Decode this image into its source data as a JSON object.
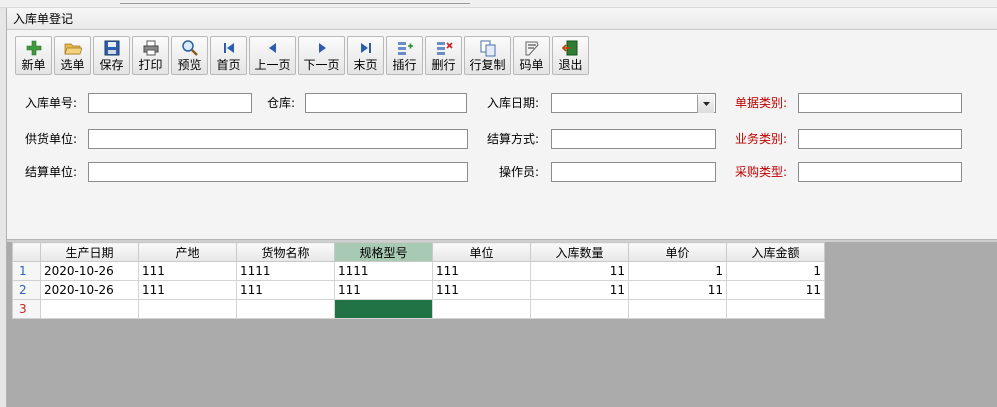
{
  "window": {
    "title": "入库单登记"
  },
  "toolbar": {
    "new": "新单",
    "select": "选单",
    "save": "保存",
    "print": "打印",
    "preview": "预览",
    "first": "首页",
    "prev": "上一页",
    "next": "下一页",
    "last": "末页",
    "insert_row": "插行",
    "delete_row": "删行",
    "copy_row": "行复制",
    "barcode": "码单",
    "exit": "退出"
  },
  "form": {
    "order_no_label": "入库单号:",
    "order_no_value": "",
    "warehouse_label": "仓库:",
    "warehouse_value": "",
    "date_label": "入库日期:",
    "date_value": "",
    "doc_type_label": "单据类别:",
    "doc_type_value": "",
    "supplier_label": "供货单位:",
    "supplier_value": "",
    "settle_method_label": "结算方式:",
    "settle_method_value": "",
    "biz_type_label": "业务类别:",
    "biz_type_value": "",
    "settle_unit_label": "结算单位:",
    "settle_unit_value": "",
    "operator_label": "操作员:",
    "operator_value": "",
    "purchase_type_label": "采购类型:",
    "purchase_type_value": ""
  },
  "grid": {
    "columns": [
      "生产日期",
      "产地",
      "货物名称",
      "规格型号",
      "单位",
      "入库数量",
      "单价",
      "入库金额"
    ],
    "rows": [
      {
        "no": "1",
        "cells": [
          "2020-10-26",
          "111",
          "1111",
          "1111",
          "111",
          "11",
          "1",
          "1"
        ]
      },
      {
        "no": "2",
        "cells": [
          "2020-10-26",
          "111",
          "111",
          "111",
          "111",
          "11",
          "11",
          "11"
        ]
      },
      {
        "no": "3",
        "cells": [
          "",
          "",
          "",
          "",
          "",
          "",
          "",
          ""
        ]
      }
    ]
  },
  "colors": {
    "active_cell": "#217346",
    "selected_header": "#a8c9b3",
    "required_label": "#c00000"
  }
}
